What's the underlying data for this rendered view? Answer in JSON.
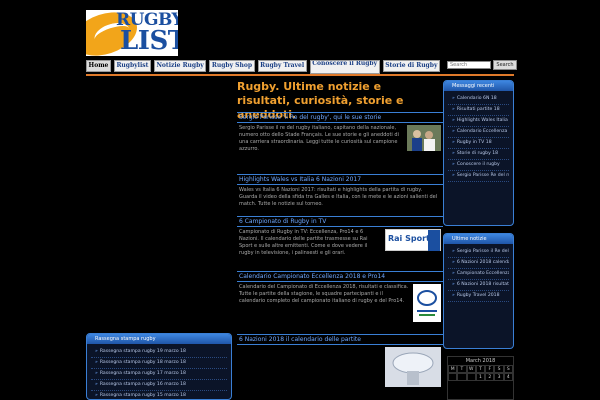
{
  "logo": {
    "line1": "RUGBY",
    "line2": "LIST"
  },
  "nav": {
    "items": [
      {
        "label": "Home"
      },
      {
        "label": "Rugbylist"
      },
      {
        "label": "Notizie Rugby"
      },
      {
        "label": "Rugby Shop"
      },
      {
        "label": "Rugby Travel"
      },
      {
        "label": "Conoscere il Rugby"
      },
      {
        "label": "Storie di Rugby"
      }
    ]
  },
  "search": {
    "placeholder": "Search",
    "button_label": "Search"
  },
  "headline": "Rugby. Ultime notizie e risultati, curiosità, storie e aneddoti.",
  "posts": [
    {
      "title": "Sergio Parisse 'il Re del rugby', qui le sue storie",
      "body": "Sergio Parisse il re del rugby italiano, capitano della nazionale, numero otto dello Stade Français. Le sue storie e gli aneddoti di una carriera straordinaria. Leggi tutte le curiosità sul campione azzurro."
    },
    {
      "title": "Highlights Wales vs Italia 6 Nazioni 2017",
      "body": "Wales vs Italia 6 Nazioni 2017: risultati e highlights della partita di rugby. Guarda il video della sfida tra Galles e Italia, con le mete e le azioni salienti del match. Tutte le notizie sul torneo."
    },
    {
      "title": "6 Campionato di Rugby in TV",
      "body": "Campionato di Rugby in TV: Eccellenza, Pro14 e 6 Nazioni. Il calendario delle partite trasmesse su Rai Sport e sulle altre emittenti. Come e dove vedere il rugby in televisione, i palinsesti e gli orari."
    },
    {
      "title": "Calendario Campionato Eccellenza 2018 e Pro14",
      "body": "Calendario del Campionato di Eccellenza 2018, risultati e classifica. Tutte le partite della stagione, le squadre partecipanti e il calendario completo del campionato italiano di rugby e del Pro14."
    },
    {
      "title": "6 Nazioni 2018 il calendario delle partite",
      "body": ""
    }
  ],
  "thumb": {
    "rai_text": "Rai Sport 1"
  },
  "sidebar": {
    "recent": {
      "title": "Messaggi recenti",
      "items": [
        "Calendario 6N 18",
        "Risultati partite 18",
        "Highlights Wales Italia",
        "Calendario Eccellenza",
        "Rugby in TV 18",
        "Storie di rugby 18",
        "Conoscere il rugby",
        "Sergio Parisse Re del rugby"
      ]
    },
    "latest": {
      "title": "Ultime notizie",
      "items": [
        "Sergio Parisse il Re del rugby 18",
        "6 Nazioni 2018 calendario",
        "Campionato Eccellenza 18",
        "6 Nazioni 2018 risultati",
        "Rugby Travel 2018"
      ]
    },
    "press": {
      "title": "Rassegna stampa rugby",
      "items": [
        "Rassegna stampa rugby 19 marzo 18",
        "Rassegna stampa rugby 18 marzo 18",
        "Rassegna stampa rugby 17 marzo 18",
        "Rassegna stampa rugby 16 marzo 18",
        "Rassegna stampa rugby 15 marzo 18"
      ]
    }
  },
  "calendar": {
    "title": "March 2018",
    "days": [
      "M",
      "T",
      "W",
      "T",
      "F",
      "S",
      "S"
    ],
    "row1": [
      "",
      "",
      "",
      "1",
      "2",
      "3",
      "4"
    ]
  },
  "colors": {
    "accent": "#3a7fd5",
    "orange": "#f0a030",
    "background": "#000000"
  }
}
